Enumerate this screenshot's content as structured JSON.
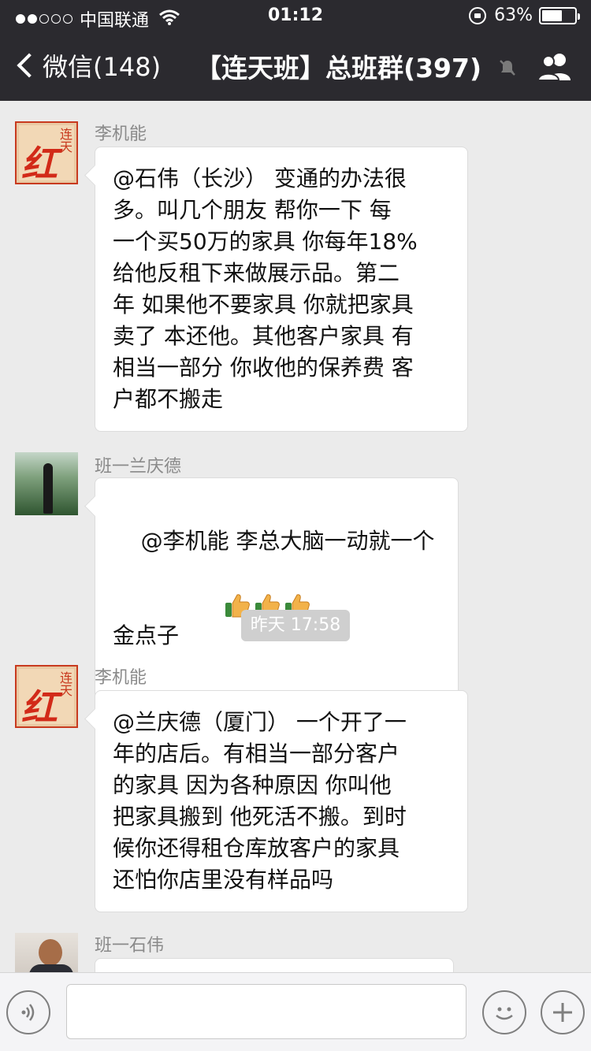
{
  "status_bar": {
    "carrier": "中国联通",
    "time": "01:12",
    "battery": "63%",
    "battery_level": 0.63,
    "signal_bars": 2,
    "signal_total": 5
  },
  "nav": {
    "back_label": "微信(148)",
    "title": "【连天班】总班群(397)"
  },
  "messages": [
    {
      "sender": "李机能",
      "avatar": "hong-seal-avatar",
      "text": "@石伟（长沙） 变通的办法很\n多。叫几个朋友 帮你一下 每\n一个买50万的家具 你每年18%\n给他反租下来做展示品。第二\n年 如果他不要家具 你就把家具\n卖了 本还他。其他客户家具 有\n相当一部分 你收他的保养费 客\n户都不搬走"
    },
    {
      "sender": "班一兰庆德",
      "avatar": "person-photo-avatar",
      "text": "@李机能 李总大脑一动就一个\n金点子",
      "emoji": [
        "thumbs-up-icon",
        "thumbs-up-icon",
        "thumbs-up-icon"
      ]
    },
    {
      "sender": "李机能",
      "avatar": "hong-seal-avatar",
      "text": "@兰庆德（厦门） 一个开了一\n年的店后。有相当一部分客户\n的家具 因为各种原因 你叫他\n把家具搬到 他死活不搬。到时\n候你还得租仓库放客户的家具\n还怕你店里没有样品吗"
    },
    {
      "sender": "班一石伟",
      "avatar": "person-phone-avatar",
      "text": ""
    }
  ],
  "timestamp": "昨天 17:58",
  "avatar_text": {
    "hong_big": "红",
    "hong_small": "连天"
  },
  "colors": {
    "topbar": "#2b2a2f",
    "background": "#ebebeb",
    "bubble": "#ffffff",
    "seal_red": "#d22a18"
  }
}
